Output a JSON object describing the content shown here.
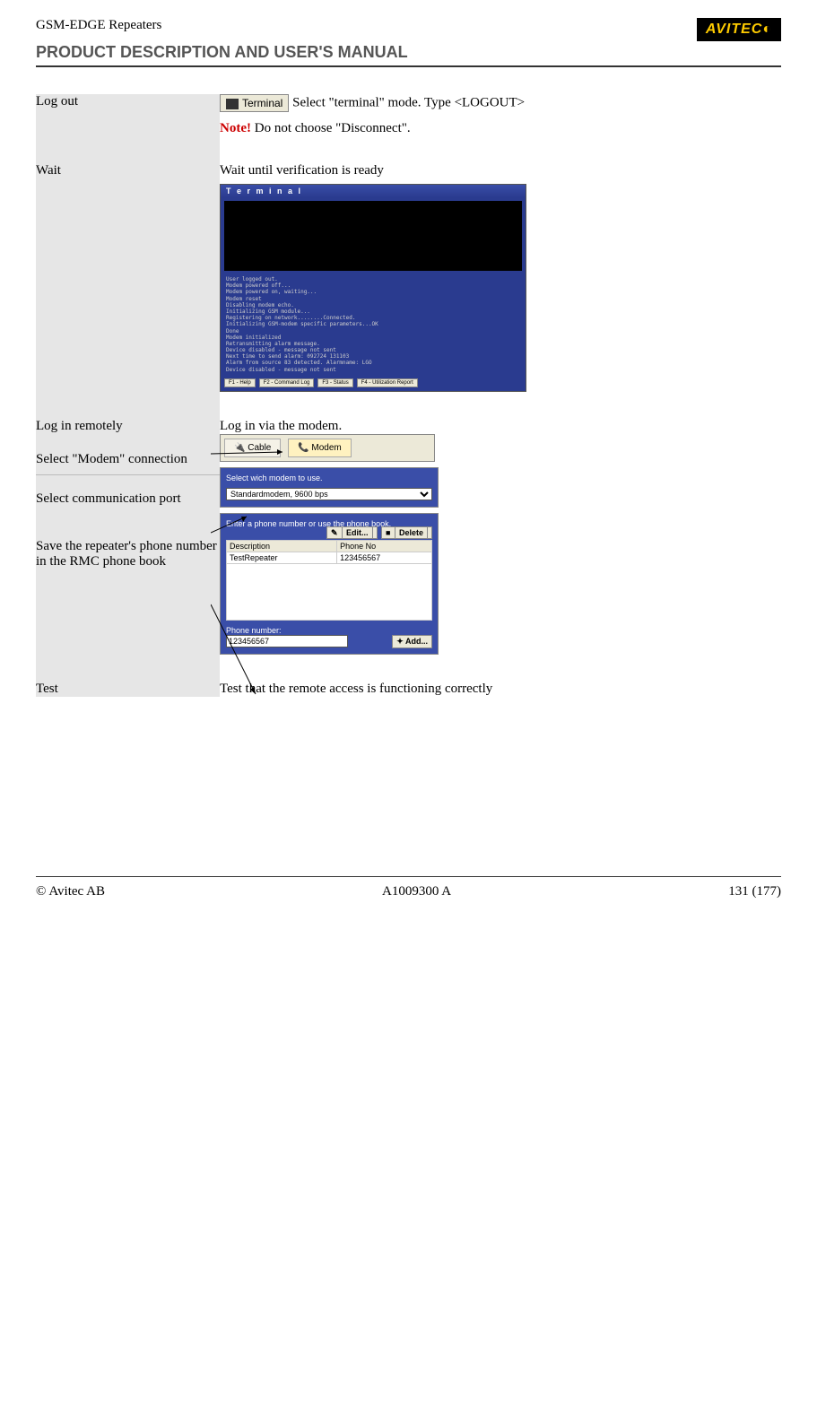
{
  "header": {
    "product_line": "GSM-EDGE Repeaters",
    "manual_title": "PRODUCT DESCRIPTION AND USER'S MANUAL",
    "logo_text": "AVITEC"
  },
  "rows": {
    "logout": {
      "label": "Log out",
      "terminal_button": "Terminal",
      "instruction": " Select \"terminal\" mode. Type <LOGOUT>",
      "note_prefix": "Note!",
      "note_text": " Do not choose \"Disconnect\"."
    },
    "wait": {
      "label": "Wait",
      "instruction": "Wait until verification is ready",
      "window_title": "T e r m i n a l",
      "terminal_lines": "User logged out.\nModem powered off...\nModem powered on, waiting...\nModem reset\nDisabling modem echo.\nInitializing GSM module...\nRegistering on network........Connected.\nInitializing GSM-modem specific parameters...OK\nDone\nModem initialized\nRetransmitting alarm message.\nDevice disabled - message not sent\nNext time to send alarm: 092724 131103\nAlarm from source 83 detected. Alarmname: LGO\nDevice disabled - message not sent",
      "fkeys": [
        "F1 - Help",
        "F2 - Command Log",
        "F3 - Status",
        "F4 - Utilization Report"
      ]
    },
    "login": {
      "label": "Log in remotely",
      "instruction": " Log in via the modem.",
      "sub1": "Select \"Modem\" connection",
      "sub2": "Select communication port",
      "sub3": "Save the repeater's phone number in the RMC phone book",
      "tab_cable": "Cable",
      "tab_modem": "Modem",
      "select_label": "Select wich modem to use.",
      "select_value": "Standardmodem,  9600 bps",
      "phone_prompt": "Enter a phone number or use the phone book.",
      "edit_btn": "Edit...",
      "delete_btn": "Delete",
      "col_desc": "Description",
      "col_phone": "Phone No",
      "row_desc": "TestRepeater",
      "row_phone": "123456567",
      "phone_label": "Phone number:",
      "phone_value": "123456567",
      "add_btn": "Add..."
    },
    "test": {
      "label": "Test",
      "instruction": "Test that the remote access is functioning correctly"
    }
  },
  "footer": {
    "left": "© Avitec AB",
    "center": "A1009300 A",
    "right": "131 (177)"
  }
}
